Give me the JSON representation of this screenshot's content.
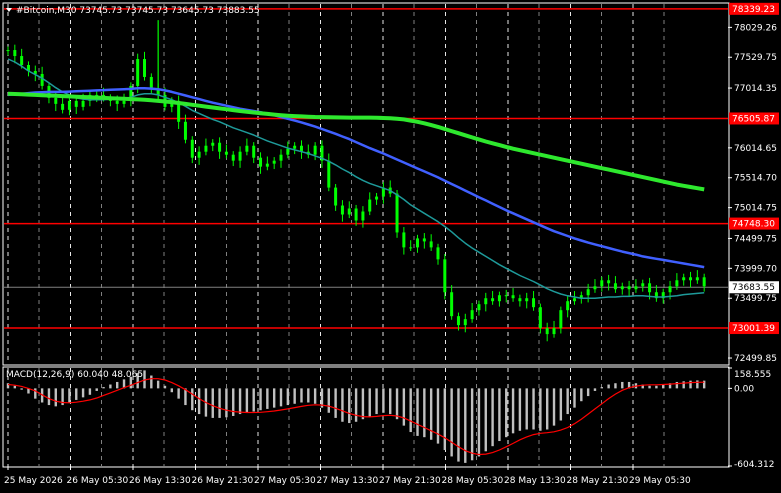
{
  "header": {
    "symbol_line": "#Bitcoin,M30  73745.73 73745.73 73645.73 73883.55"
  },
  "subwindow": {
    "label": "MACD(12,26,9) 60.040 48.065"
  },
  "colors": {
    "background": "#000000",
    "grid": "#ffffff",
    "candle_up": "#00ff00",
    "candle_down": "#00ff00",
    "ma_fast": "#1e9a9a",
    "ma_mid": "#4060ff",
    "ma_slow": "#2ee82e",
    "level_line": "#ff0000",
    "histogram": "#c0c0c0",
    "signal": "#ff0000"
  },
  "chart_data": [
    {
      "type": "candlestick",
      "title": "#Bitcoin,M30",
      "ylim": [
        72400,
        78420
      ],
      "y_ticks": [
        "78029.26",
        "77529.75",
        "77014.35",
        "76014.65",
        "75514.70",
        "75014.75",
        "74499.75",
        "73999.70",
        "73499.75",
        "72499.85"
      ],
      "x_ticks": [
        "25 May 2026",
        "26 May 05:30",
        "26 May 13:30",
        "26 May 21:30",
        "27 May 05:30",
        "27 May 13:30",
        "27 May 21:30",
        "28 May 05:30",
        "28 May 13:30",
        "28 May 21:30",
        "29 May 05:30"
      ],
      "levels": [
        {
          "value": 78339.23,
          "label": "78339.23"
        },
        {
          "value": 76505.87,
          "label": "76505.87"
        },
        {
          "value": 74748.3,
          "label": "74748.30"
        },
        {
          "value": 73001.39,
          "label": "73001.39"
        }
      ],
      "current_price": {
        "value": 73683.55,
        "label": "73683.55"
      },
      "series": [
        {
          "name": "Close",
          "values": [
            77650,
            77550,
            77400,
            77300,
            77250,
            77050,
            76850,
            76750,
            76650,
            76800,
            76700,
            76800,
            76900,
            76900,
            76850,
            76800,
            76750,
            76800,
            77050,
            77500,
            77200,
            77000,
            76900,
            76700,
            76800,
            76450,
            76150,
            75850,
            75950,
            76050,
            76100,
            75950,
            75900,
            75800,
            75950,
            76050,
            75850,
            75700,
            75750,
            75800,
            75900,
            76000,
            76050,
            75950,
            75900,
            76050,
            75800,
            75350,
            75050,
            74900,
            75000,
            74800,
            74950,
            75150,
            75200,
            75350,
            75250,
            74600,
            74350,
            74350,
            74500,
            74450,
            74350,
            74150,
            73600,
            73200,
            73050,
            73150,
            73300,
            73400,
            73500,
            73450,
            73550,
            73550,
            73500,
            73450,
            73500,
            73350,
            73000,
            72900,
            73000,
            73300,
            73450,
            73500,
            73550,
            73650,
            73700,
            73800,
            73750,
            73650,
            73700,
            73650,
            73700,
            73750,
            73600,
            73500,
            73600,
            73700,
            73800,
            73850,
            73800,
            73850,
            73700
          ]
        },
        {
          "name": "MA fast",
          "values": [
            77500,
            77450,
            77380,
            77300,
            77240,
            77180,
            77100,
            77020,
            76950,
            76900,
            76850,
            76830,
            76820,
            76820,
            76820,
            76830,
            76830,
            76840,
            76860,
            76900,
            76920,
            76920,
            76900,
            76860,
            76820,
            76770,
            76710,
            76640,
            76590,
            76540,
            76490,
            76450,
            76400,
            76350,
            76310,
            76270,
            76230,
            76180,
            76130,
            76090,
            76050,
            76010,
            75980,
            75950,
            75920,
            75880,
            75840,
            75790,
            75730,
            75660,
            75600,
            75530,
            75470,
            75420,
            75380,
            75340,
            75300,
            75230,
            75150,
            75060,
            74990,
            74920,
            74850,
            74780,
            74700,
            74610,
            74510,
            74420,
            74340,
            74270,
            74200,
            74130,
            74060,
            74000,
            73940,
            73880,
            73830,
            73780,
            73720,
            73660,
            73610,
            73570,
            73540,
            73520,
            73500,
            73500,
            73500,
            73510,
            73520,
            73520,
            73530,
            73530,
            73540,
            73540,
            73530,
            73520,
            73520,
            73530,
            73540,
            73560,
            73570,
            73580,
            73590
          ]
        },
        {
          "name": "MA mid",
          "values": [
            76900,
            76910,
            76920,
            76930,
            76940,
            76945,
            76950,
            76950,
            76950,
            76955,
            76960,
            76965,
            76970,
            76975,
            76980,
            76985,
            76990,
            76995,
            77000,
            77010,
            77010,
            77005,
            76995,
            76975,
            76950,
            76920,
            76890,
            76860,
            76830,
            76800,
            76770,
            76745,
            76720,
            76695,
            76670,
            76650,
            76630,
            76610,
            76585,
            76560,
            76530,
            76500,
            76470,
            76440,
            76405,
            76370,
            76330,
            76290,
            76250,
            76205,
            76160,
            76110,
            76060,
            76010,
            75965,
            75920,
            75870,
            75820,
            75770,
            75720,
            75670,
            75620,
            75570,
            75520,
            75465,
            75410,
            75355,
            75300,
            75245,
            75190,
            75135,
            75080,
            75025,
            74970,
            74920,
            74870,
            74820,
            74770,
            74720,
            74670,
            74620,
            74580,
            74540,
            74500,
            74465,
            74430,
            74400,
            74370,
            74340,
            74310,
            74280,
            74255,
            74230,
            74200,
            74180,
            74160,
            74140,
            74120,
            74100,
            74080,
            74060,
            74040,
            74020
          ]
        },
        {
          "name": "MA slow",
          "values": [
            76920,
            76915,
            76910,
            76905,
            76900,
            76895,
            76890,
            76885,
            76880,
            76875,
            76870,
            76865,
            76860,
            76855,
            76850,
            76845,
            76840,
            76835,
            76830,
            76825,
            76820,
            76810,
            76800,
            76790,
            76780,
            76765,
            76750,
            76735,
            76720,
            76705,
            76690,
            76675,
            76660,
            76645,
            76630,
            76618,
            76606,
            76594,
            76582,
            76570,
            76560,
            76552,
            76545,
            76540,
            76535,
            76530,
            76528,
            76526,
            76524,
            76522,
            76520,
            76520,
            76520,
            76520,
            76518,
            76514,
            76508,
            76500,
            76490,
            76470,
            76450,
            76425,
            76395,
            76365,
            76330,
            76295,
            76260,
            76225,
            76190,
            76155,
            76120,
            76090,
            76060,
            76030,
            76000,
            75975,
            75950,
            75925,
            75900,
            75875,
            75850,
            75825,
            75800,
            75775,
            75750,
            75725,
            75700,
            75675,
            75650,
            75625,
            75600,
            75575,
            75550,
            75525,
            75500,
            75475,
            75450,
            75425,
            75400,
            75380,
            75360,
            75340,
            75320
          ]
        }
      ]
    },
    {
      "type": "bar",
      "title": "MACD(12,26,9) 60.040 48.065",
      "ylim": [
        -604.312,
        158.555
      ],
      "y_ticks": [
        "158.555",
        "0.00",
        "-604.312"
      ],
      "series": [
        {
          "name": "MACD",
          "values": [
            40,
            20,
            -10,
            -40,
            -80,
            -110,
            -130,
            -140,
            -130,
            -110,
            -90,
            -70,
            -50,
            -20,
            10,
            30,
            50,
            70,
            90,
            120,
            140,
            100,
            60,
            20,
            -30,
            -80,
            -130,
            -170,
            -200,
            -220,
            -230,
            -230,
            -225,
            -215,
            -200,
            -190,
            -180,
            -170,
            -160,
            -150,
            -140,
            -130,
            -120,
            -110,
            -110,
            -120,
            -150,
            -190,
            -230,
            -260,
            -270,
            -260,
            -240,
            -220,
            -200,
            -190,
            -200,
            -240,
            -290,
            -340,
            -370,
            -380,
            -400,
            -430,
            -480,
            -530,
            -570,
            -580,
            -560,
            -530,
            -490,
            -450,
            -410,
            -380,
            -350,
            -330,
            -320,
            -320,
            -330,
            -320,
            -290,
            -250,
            -200,
            -150,
            -100,
            -60,
            -20,
            10,
            30,
            40,
            50,
            50,
            40,
            30,
            20,
            20,
            30,
            40,
            50,
            55,
            60,
            62,
            60
          ]
        },
        {
          "name": "Signal",
          "values": [
            30,
            25,
            15,
            0,
            -20,
            -50,
            -80,
            -100,
            -110,
            -112,
            -108,
            -100,
            -90,
            -75,
            -55,
            -35,
            -15,
            5,
            25,
            45,
            65,
            75,
            75,
            65,
            45,
            20,
            -10,
            -45,
            -80,
            -110,
            -135,
            -155,
            -170,
            -180,
            -185,
            -188,
            -188,
            -186,
            -182,
            -176,
            -168,
            -160,
            -150,
            -140,
            -132,
            -128,
            -130,
            -138,
            -155,
            -175,
            -195,
            -210,
            -220,
            -222,
            -218,
            -212,
            -210,
            -215,
            -230,
            -255,
            -280,
            -305,
            -330,
            -355,
            -385,
            -420,
            -455,
            -485,
            -505,
            -515,
            -512,
            -500,
            -480,
            -455,
            -428,
            -400,
            -378,
            -360,
            -350,
            -345,
            -338,
            -325,
            -305,
            -275,
            -240,
            -200,
            -160,
            -120,
            -80,
            -45,
            -15,
            5,
            18,
            25,
            28,
            28,
            30,
            33,
            37,
            41,
            45,
            47,
            48
          ]
        }
      ]
    }
  ]
}
